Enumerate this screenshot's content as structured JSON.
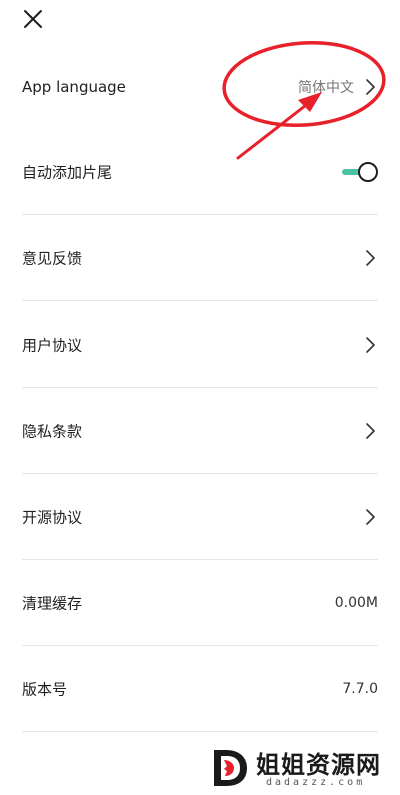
{
  "header": {
    "close_icon": "close-icon"
  },
  "settings": {
    "app_language": {
      "label": "App language",
      "value": "简体中文"
    },
    "auto_outro": {
      "label": "自动添加片尾",
      "enabled": true
    },
    "feedback": {
      "label": "意见反馈"
    },
    "user_agreement": {
      "label": "用户协议"
    },
    "privacy_policy": {
      "label": "隐私条款"
    },
    "open_source": {
      "label": "开源协议"
    },
    "clear_cache": {
      "label": "清理缓存",
      "value": "0.00M"
    },
    "version": {
      "label": "版本号",
      "value": "7.7.0"
    }
  },
  "colors": {
    "toggle_on": "#4cc2a3",
    "annotation": "#e8202a",
    "divider": "#e6e6e6"
  },
  "watermark": {
    "title": "姐姐资源网",
    "subtitle": "dadazzz.com"
  }
}
